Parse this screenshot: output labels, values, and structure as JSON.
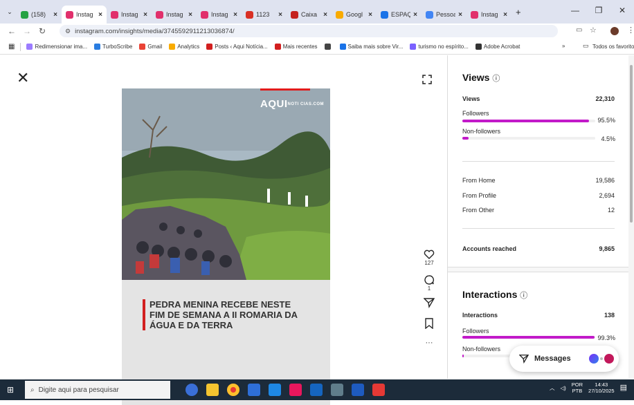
{
  "browser": {
    "tabs": [
      {
        "label": "(158)",
        "color": "#25a244"
      },
      {
        "label": "Instag",
        "color": "#e1306c",
        "active": true
      },
      {
        "label": "Instag",
        "color": "#e1306c"
      },
      {
        "label": "Instag",
        "color": "#e1306c"
      },
      {
        "label": "Instag",
        "color": "#e1306c"
      },
      {
        "label": "1123",
        "color": "#d93025"
      },
      {
        "label": "Caixa",
        "color": "#c5221f"
      },
      {
        "label": "Googl",
        "color": "#f9ab00"
      },
      {
        "label": "ESPAÇ",
        "color": "#1a73e8"
      },
      {
        "label": "Pessoa",
        "color": "#4285f4"
      },
      {
        "label": "Instag",
        "color": "#e1306c"
      }
    ],
    "tab_close": "×",
    "new_tab": "+",
    "url": "instagram.com/insights/media/3745592911213036874/",
    "bookmarks": [
      {
        "label": "Redimensionar ima...",
        "color": "#9c7cff"
      },
      {
        "label": "TurboScribe",
        "color": "#2a7de1"
      },
      {
        "label": "Gmail",
        "color": "#ea4335"
      },
      {
        "label": "Analytics",
        "color": "#f9ab00"
      },
      {
        "label": "Posts ‹ Aqui Notícia...",
        "color": "#d21f1f"
      },
      {
        "label": "Mais recentes",
        "color": "#d21f1f"
      },
      {
        "label": "",
        "color": "#444"
      },
      {
        "label": "Saiba mais sobre Vir...",
        "color": "#1a73e8"
      },
      {
        "label": "turismo no espírito...",
        "color": "#7b61ff"
      },
      {
        "label": "Adobe Acrobat",
        "color": "#333"
      }
    ],
    "bookmarks_more": "»",
    "bookmarks_all": "Todos os favoritos"
  },
  "post": {
    "logo_main": "AQUI",
    "logo_small": "NOTI CIAS.COM",
    "headline": "PEDRA MENINA RECEBE NESTE FIM DE SEMANA A II ROMARIA DA ÁGUA E DA TERRA",
    "likes": "127",
    "comments": "1",
    "more": "···"
  },
  "insights": {
    "views_title": "Views",
    "views": {
      "label": "Views",
      "value": "22,310"
    },
    "followers": {
      "label": "Followers",
      "pct": "95.5%",
      "frac": 0.955
    },
    "non_followers": {
      "label": "Non-followers",
      "pct": "4.5%",
      "frac": 0.045
    },
    "from_home": {
      "label": "From Home",
      "value": "19,586"
    },
    "from_profile": {
      "label": "From Profile",
      "value": "2,694"
    },
    "from_other": {
      "label": "From Other",
      "value": "12"
    },
    "accounts_reached": {
      "label": "Accounts reached",
      "value": "9,865"
    },
    "interactions_title": "Interactions",
    "interactions": {
      "label": "Interactions",
      "value": "138"
    },
    "int_followers": {
      "label": "Followers",
      "pct": "99.3%",
      "frac": 0.993
    },
    "int_non_followers": {
      "label": "Non-followers",
      "frac": 0.007
    },
    "accent": "#c21ac9"
  },
  "messages": {
    "label": "Messages"
  },
  "taskbar": {
    "search_placeholder": "Digite aqui para pesquisar",
    "lang1": "POR",
    "lang2": "PTB",
    "time": "14:43",
    "date": "27/10/2025"
  }
}
